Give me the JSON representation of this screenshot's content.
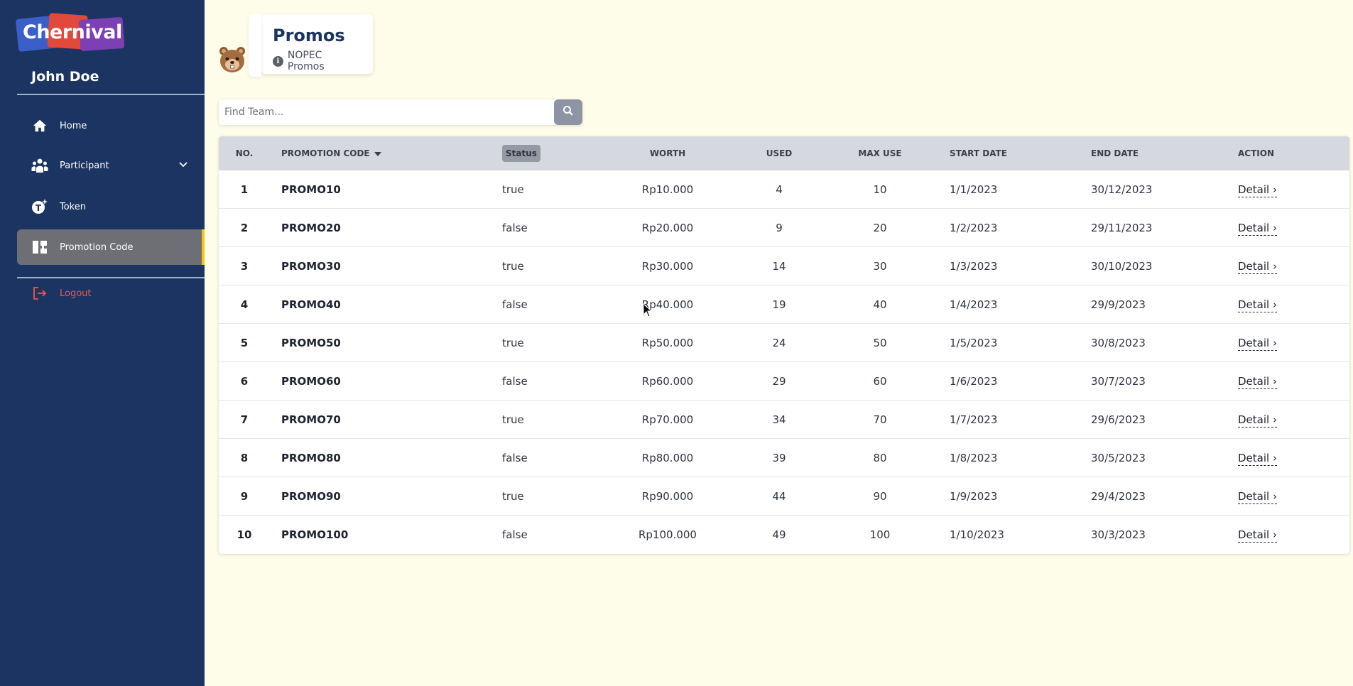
{
  "brand": {
    "name": "Chernival"
  },
  "user": {
    "name": "John Doe"
  },
  "sidebar": {
    "items": [
      {
        "label": "Home",
        "icon": "home-icon"
      },
      {
        "label": "Participant",
        "icon": "users-icon"
      },
      {
        "label": "Token",
        "icon": "token-icon"
      },
      {
        "label": "Promotion Code",
        "icon": "ticket-icon"
      }
    ],
    "logout_label": "Logout"
  },
  "header": {
    "title": "Promos",
    "subtitle": "NOPEC Promos"
  },
  "search": {
    "placeholder": "Find Team..."
  },
  "table": {
    "columns": [
      "NO.",
      "PROMOTION CODE",
      "Status",
      "WORTH",
      "USED",
      "MAX USE",
      "START DATE",
      "END DATE",
      "ACTION"
    ],
    "rows": [
      {
        "no": "1",
        "code": "PROMO10",
        "status": "true",
        "worth": "Rp10.000",
        "used": "4",
        "max": "10",
        "start": "1/1/2023",
        "end": "30/12/2023",
        "action": "Detail ›"
      },
      {
        "no": "2",
        "code": "PROMO20",
        "status": "false",
        "worth": "Rp20.000",
        "used": "9",
        "max": "20",
        "start": "1/2/2023",
        "end": "29/11/2023",
        "action": "Detail ›"
      },
      {
        "no": "3",
        "code": "PROMO30",
        "status": "true",
        "worth": "Rp30.000",
        "used": "14",
        "max": "30",
        "start": "1/3/2023",
        "end": "30/10/2023",
        "action": "Detail ›"
      },
      {
        "no": "4",
        "code": "PROMO40",
        "status": "false",
        "worth": "Rp40.000",
        "used": "19",
        "max": "40",
        "start": "1/4/2023",
        "end": "29/9/2023",
        "action": "Detail ›"
      },
      {
        "no": "5",
        "code": "PROMO50",
        "status": "true",
        "worth": "Rp50.000",
        "used": "24",
        "max": "50",
        "start": "1/5/2023",
        "end": "30/8/2023",
        "action": "Detail ›"
      },
      {
        "no": "6",
        "code": "PROMO60",
        "status": "false",
        "worth": "Rp60.000",
        "used": "29",
        "max": "60",
        "start": "1/6/2023",
        "end": "30/7/2023",
        "action": "Detail ›"
      },
      {
        "no": "7",
        "code": "PROMO70",
        "status": "true",
        "worth": "Rp70.000",
        "used": "34",
        "max": "70",
        "start": "1/7/2023",
        "end": "29/6/2023",
        "action": "Detail ›"
      },
      {
        "no": "8",
        "code": "PROMO80",
        "status": "false",
        "worth": "Rp80.000",
        "used": "39",
        "max": "80",
        "start": "1/8/2023",
        "end": "30/5/2023",
        "action": "Detail ›"
      },
      {
        "no": "9",
        "code": "PROMO90",
        "status": "true",
        "worth": "Rp90.000",
        "used": "44",
        "max": "90",
        "start": "1/9/2023",
        "end": "29/4/2023",
        "action": "Detail ›"
      },
      {
        "no": "10",
        "code": "PROMO100",
        "status": "false",
        "worth": "Rp100.000",
        "used": "49",
        "max": "100",
        "start": "1/10/2023",
        "end": "30/3/2023",
        "action": "Detail ›"
      }
    ]
  },
  "colors": {
    "sidebar": "#1c3461",
    "background": "#fefde9",
    "active_accent": "#f5c518",
    "logout": "#f0574a"
  }
}
